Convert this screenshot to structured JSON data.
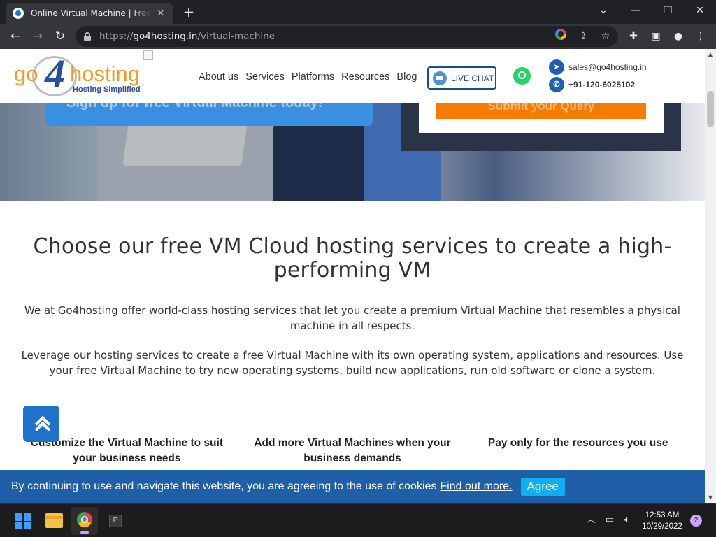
{
  "browser": {
    "tab_title": "Online Virtual Machine | Free Online Virtual Machine",
    "tab_close": "✕",
    "new_tab": "+",
    "url_prefix": "https://",
    "url_host": "go4hosting.in",
    "url_path": "/virtual-machine",
    "win_minimize": "—",
    "win_restore": "❐",
    "win_close": "✕",
    "tab_dropdown": "⌄"
  },
  "site": {
    "logo": {
      "go": "go",
      "four": "4",
      "hosting": "hosting",
      "tagline": "Hosting Simplified"
    },
    "nav": [
      "About us",
      "Services",
      "Platforms",
      "Resources",
      "Blog"
    ],
    "live_chat": "LIVE CHAT",
    "email": "sales@go4hosting.in",
    "phone": "+91-120-6025102",
    "hero": {
      "signup": "Sign up for free Virtual Machine today!",
      "query_button": "Submit your Query"
    },
    "heading": "Choose our free VM Cloud hosting services to create a high-performing VM",
    "paragraph1": "We at Go4hosting offer world-class hosting services that let you create a premium Virtual Machine that resembles a physical machine in all respects.",
    "paragraph2": "Leverage our hosting services to create a free Virtual Machine with its own operating system, applications and resources. Use your free Virtual Machine to try new operating systems, build new applications, run old software or clone a system.",
    "features": [
      "Customize the Virtual Machine to suit your business needs",
      "Add more Virtual Machines when your business demands",
      "Pay only for the resources you use"
    ],
    "cookie": {
      "text": "By continuing to use and navigate this website, you are agreeing to the use of cookies",
      "link": "Find out more.",
      "button": "Agree"
    }
  },
  "taskbar": {
    "time": "12:53 AM",
    "date": "10/29/2022",
    "notifications": "2",
    "pinned_label": "P"
  },
  "colors": {
    "accent": "#1f5fa8",
    "logo_orange": "#f29a1f",
    "logo_blue": "#2a4e9b",
    "agree": "#10b0f0",
    "query_orange": "#f57c00"
  }
}
